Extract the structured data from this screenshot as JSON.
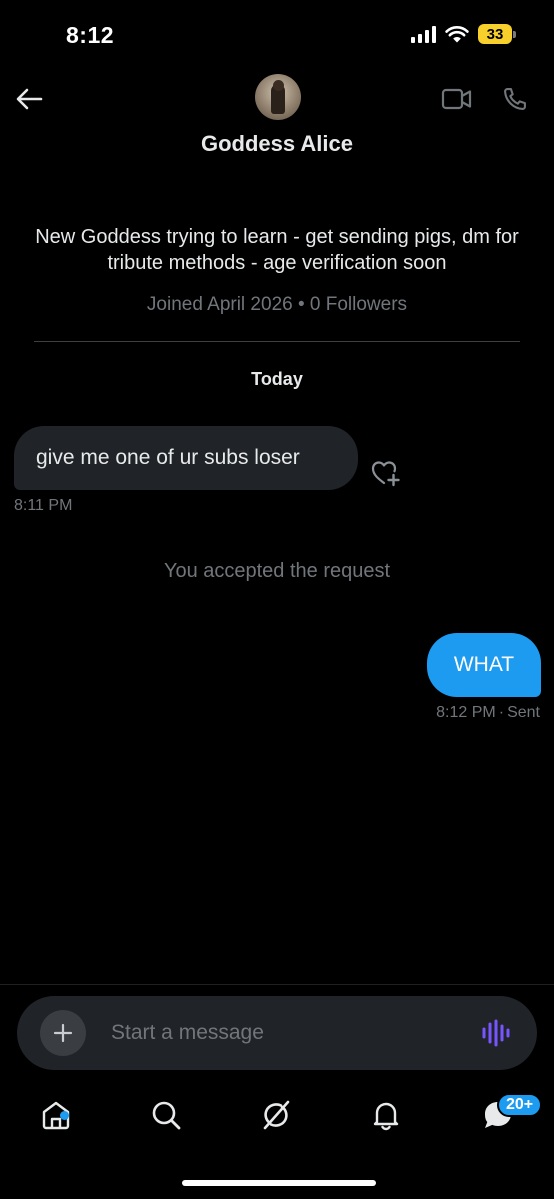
{
  "status_bar": {
    "time": "8:12",
    "battery_level": "33",
    "icons": [
      "cellular-signal-icon",
      "wifi-icon",
      "battery-icon"
    ]
  },
  "header": {
    "name": "Goddess Alice",
    "icons": [
      "back-arrow-icon",
      "video-call-icon",
      "phone-icon"
    ]
  },
  "profile": {
    "bio": "New Goddess trying to learn - get sending pigs, dm for tribute methods - age verification soon",
    "meta": "Joined April 2026 • 0 Followers"
  },
  "conversation": {
    "date_separator": "Today",
    "messages": [
      {
        "direction": "incoming",
        "text": "give me one of ur subs loser",
        "time": "8:11 PM"
      },
      {
        "direction": "system",
        "text": "You accepted the request"
      },
      {
        "direction": "outgoing",
        "text": "WHAT",
        "time": "8:12 PM",
        "status": "Sent"
      }
    ]
  },
  "composer": {
    "placeholder": "Start a message",
    "icons": [
      "plus-icon",
      "voice-waveform-icon"
    ]
  },
  "tab_bar": {
    "tabs": [
      "home-icon",
      "search-icon",
      "grok-icon",
      "notifications-icon",
      "messages-icon"
    ],
    "messages_badge": "20+"
  },
  "colors": {
    "background": "#000000",
    "accent": "#1d9bf0",
    "incoming_bubble": "#202327",
    "muted_text": "#71767b",
    "voice_icon": "#7856ff",
    "battery": "#f7d02c"
  }
}
